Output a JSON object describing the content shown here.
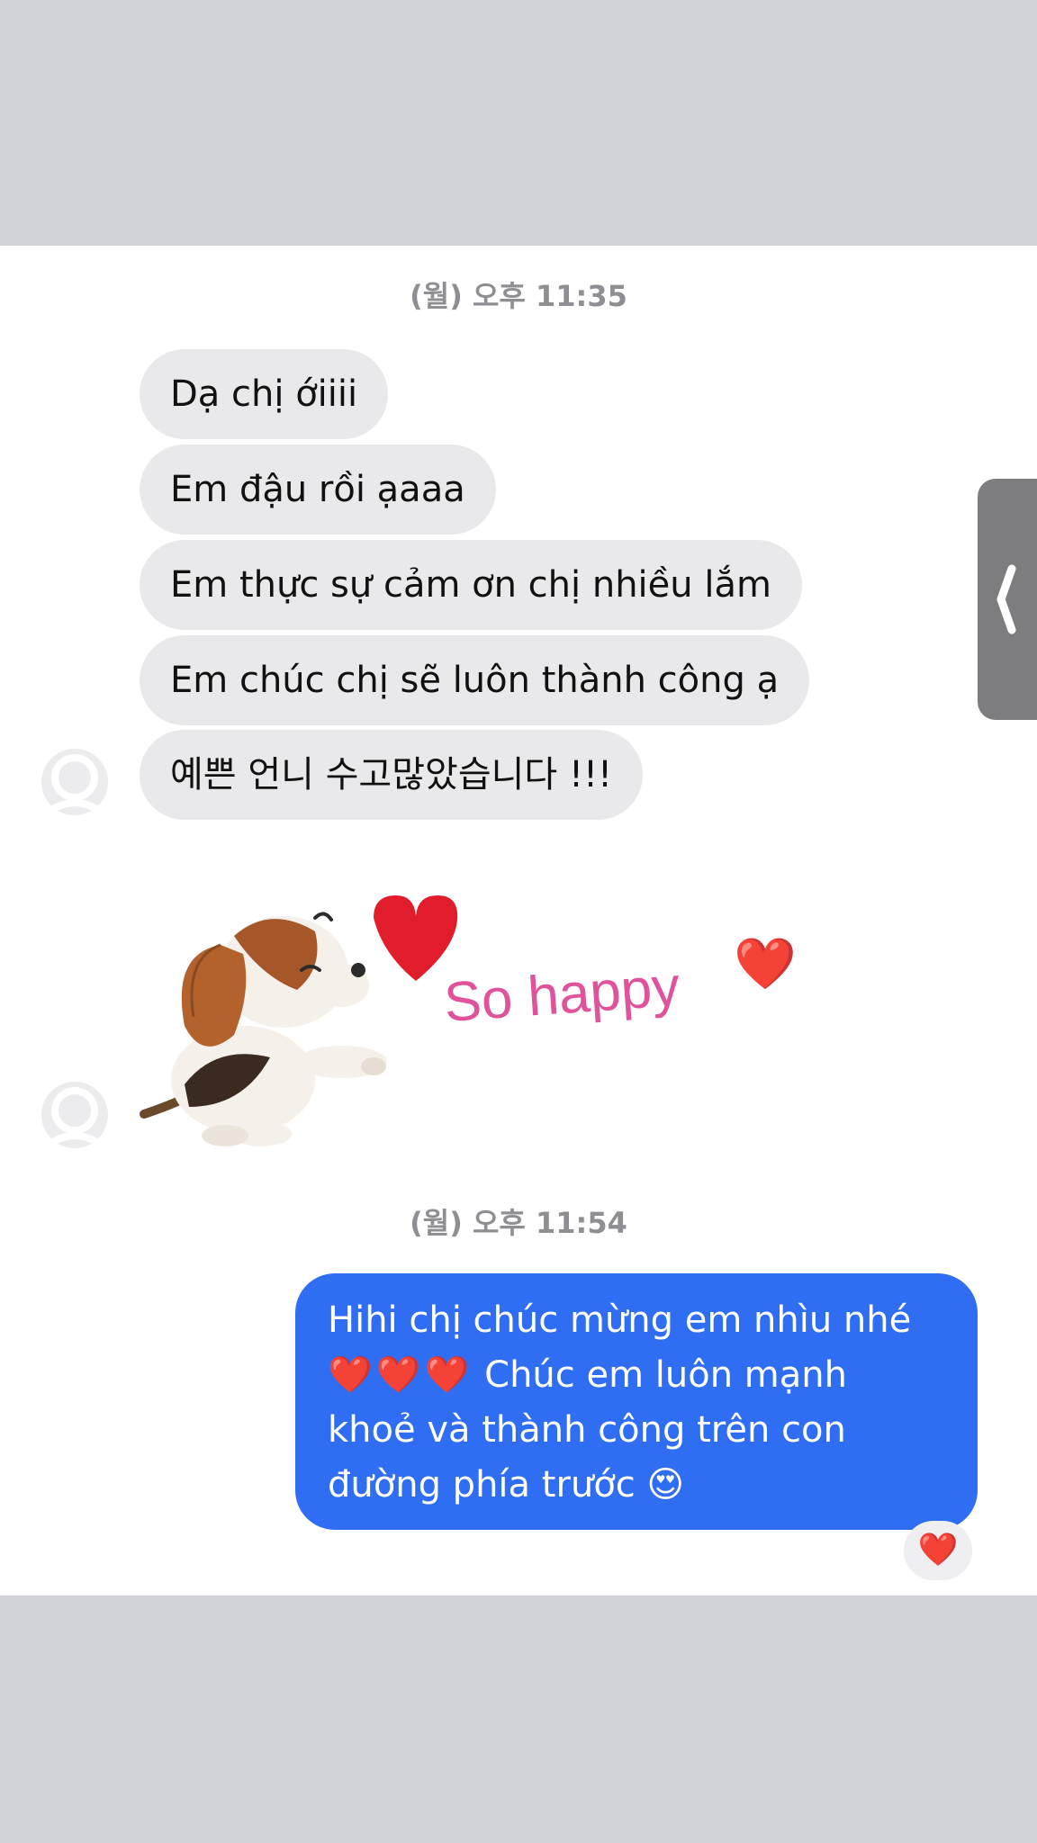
{
  "conversation": {
    "timestamp_1": "(월) 오후 11:35",
    "incoming_messages": [
      "Dạ chị ớiiii",
      "Em đậu rồi ạaaa",
      "Em thực sự cảm ơn chị nhiều lắm",
      "Em chúc chị sẽ luôn thành công ạ",
      "예쁜 언니 수고많았습니다 !!!"
    ],
    "sticker": {
      "text": "So happy",
      "heart_emoji": "❤️",
      "icon": "beagle-puppy-heart-sticker"
    },
    "timestamp_2": "(월) 오후 11:54",
    "outgoing_message": {
      "line_1": "Hihi chị chúc mừng em nhìu nhé",
      "hearts": "❤️❤️❤️",
      "line_2_text": "Chúc em luôn mạnh",
      "line_3": "khoẻ và thành công trên con",
      "line_4_text": "đường phía trước",
      "line_4_emoji": "😍"
    },
    "reaction": "❤️"
  },
  "colors": {
    "outgoing_bubble": "#2f6ef3",
    "incoming_bubble": "#e9e9eb",
    "sticker_text": "#e0529a",
    "heart": "#e11d2b"
  }
}
